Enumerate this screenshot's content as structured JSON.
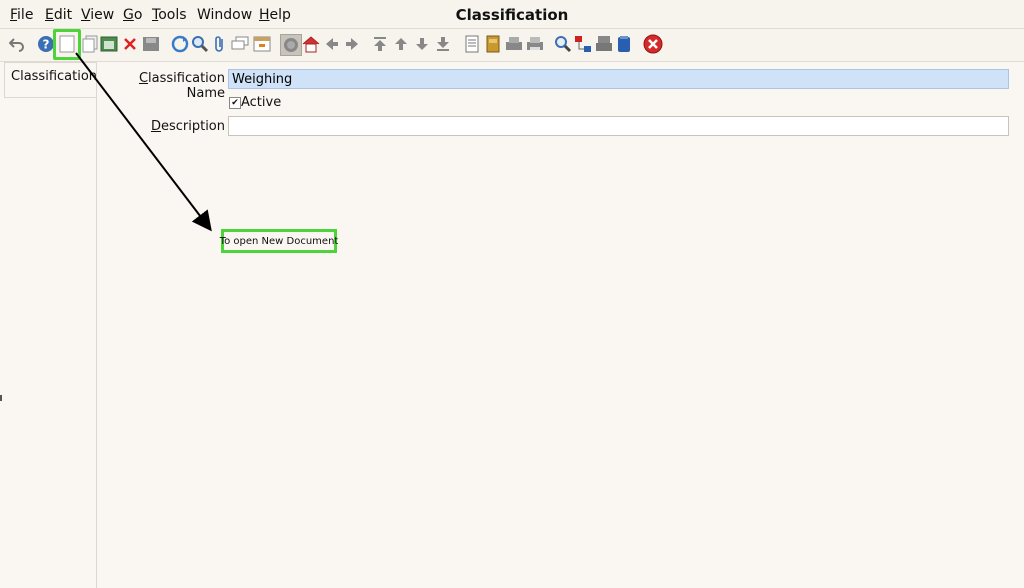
{
  "menubar": {
    "items": [
      {
        "hot": "F",
        "rest": "ile"
      },
      {
        "hot": "E",
        "rest": "dit"
      },
      {
        "hot": "V",
        "rest": "iew"
      },
      {
        "hot": "G",
        "rest": "o"
      },
      {
        "hot": "T",
        "rest": "ools"
      },
      {
        "hot": "",
        "rest": "Window"
      },
      {
        "hot": "H",
        "rest": "elp"
      }
    ]
  },
  "window_title": "Classification",
  "toolbar": {
    "icons": [
      "undo-icon",
      "help-icon",
      "new-record-icon",
      "copy-record-icon",
      "save-new-icon",
      "delete-icon",
      "save-icon",
      "refresh-icon",
      "find-icon",
      "attachment-icon",
      "chat-icon",
      "info-window-icon",
      "history-icon",
      "home-icon",
      "back-icon",
      "forward-icon",
      "first-record-icon",
      "previous-record-icon",
      "next-record-icon",
      "last-record-icon",
      "report-icon",
      "archive-icon",
      "print-preview-icon",
      "print-icon",
      "zoom-across-icon",
      "workflow-icon",
      "request-icon",
      "product-info-icon",
      "close-window-icon"
    ]
  },
  "sidebar": {
    "tab_label": "Classification"
  },
  "form": {
    "name_label_hot": "C",
    "name_label_rest": "lassification Name",
    "name_value": "Weighing",
    "active_label": "Active",
    "active_checked": true,
    "description_label_hot": "D",
    "description_label_rest": "escription",
    "description_value": ""
  },
  "annotation": {
    "tooltip_text": "To open New Document"
  },
  "colors": {
    "highlight": "#4dd43a",
    "name_field_bg": "#cfe2f7",
    "background": "#faf7f2"
  }
}
